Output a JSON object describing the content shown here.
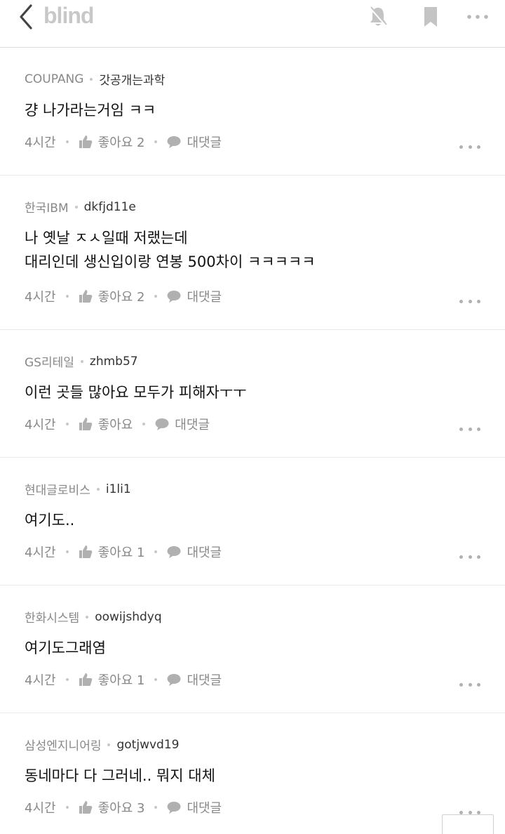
{
  "header": {
    "logo": "blind",
    "back_icon": "chevron-left-icon",
    "notification_icon": "bell-off-icon",
    "bookmark_icon": "bookmark-icon",
    "more_icon": "more-horizontal-icon"
  },
  "comments": [
    {
      "company": "COUPANG",
      "nickname": "갓공개는과학",
      "body": "걍 나가라는거임 ㅋㅋ",
      "time": "4시간",
      "like": "좋아요 2",
      "reply": "대댓글"
    },
    {
      "company": "한국IBM",
      "nickname": "dkfjd11e",
      "body": "나 옛날 ㅈㅅ일때 저랬는데\n대리인데 생신입이랑 연봉 500차이 ㅋㅋㅋㅋㅋ",
      "time": "4시간",
      "like": "좋아요 2",
      "reply": "대댓글"
    },
    {
      "company": "GS리테일",
      "nickname": "zhmb57",
      "body": "이런 곳들 많아요 모두가 피해자ㅜㅜ",
      "time": "4시간",
      "like": "좋아요",
      "reply": "대댓글"
    },
    {
      "company": "현대글로비스",
      "nickname": "i1li1",
      "body": "여기도..",
      "time": "4시간",
      "like": "좋아요 1",
      "reply": "대댓글"
    },
    {
      "company": "한화시스템",
      "nickname": "oowijshdyq",
      "body": "여기도그래염",
      "time": "4시간",
      "like": "좋아요 1",
      "reply": "대댓글"
    },
    {
      "company": "삼성엔지니어링",
      "nickname": "gotjwvd19",
      "body": "동네마다 다 그러네.. 뭐지 대체",
      "time": "4시간",
      "like": "좋아요 3",
      "reply": "대댓글"
    }
  ],
  "colors": {
    "logo": "#c8c8c8",
    "icon_gray": "#b0b0b0",
    "meta_text": "#888888",
    "body_text": "#111111",
    "divider": "#ebebeb"
  }
}
